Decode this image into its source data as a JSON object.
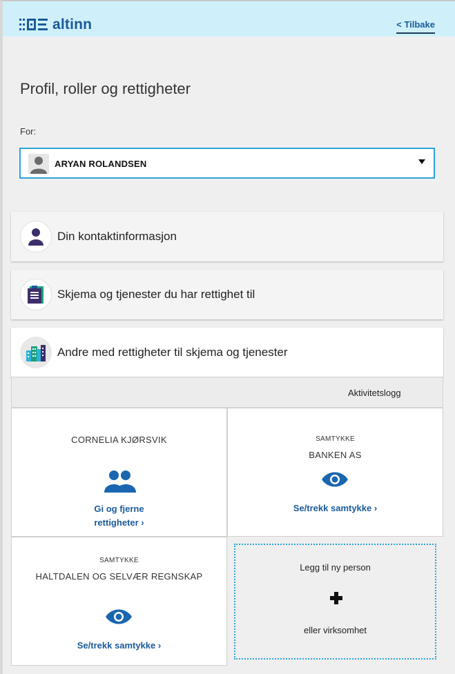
{
  "header": {
    "logo_text": "altinn",
    "back_label": "< Tilbake"
  },
  "page": {
    "title": "Profil, roller og rettigheter",
    "for_label": "For:",
    "selected_person": "ARYAN ROLANDSEN"
  },
  "sections": [
    {
      "title": "Din kontaktinformasjon",
      "icon": "person-icon"
    },
    {
      "title": "Skjema og tjenester du har rettighet til",
      "icon": "forms-icon"
    },
    {
      "title": "Andre med rettigheter til skjema og tjenester",
      "icon": "buildings-icon"
    }
  ],
  "activity_log": "Aktivitetslogg",
  "cards": [
    {
      "kicker": "",
      "name": "CORNELIA KJØRSVIK",
      "action_line1": "Gi og fjerne",
      "action_line2": "rettigheter ›",
      "icon": "people-icon"
    },
    {
      "kicker": "SAMTYKKE",
      "name": "BANKEN AS",
      "action": "Se/trekk samtykke ›",
      "icon": "eye-icon"
    },
    {
      "kicker": "SAMTYKKE",
      "name": "HALTDALEN OG SELVÆR REGNSKAP",
      "action": "Se/trekk samtykke ›",
      "icon": "eye-icon"
    }
  ],
  "add_card": {
    "line1": "Legg til ny person",
    "line2": "eller virksomhet",
    "icon": "plus-icon"
  },
  "colors": {
    "topbar": "#cff0fb",
    "link": "#1a5a9a",
    "focus": "#2aa3d8"
  }
}
